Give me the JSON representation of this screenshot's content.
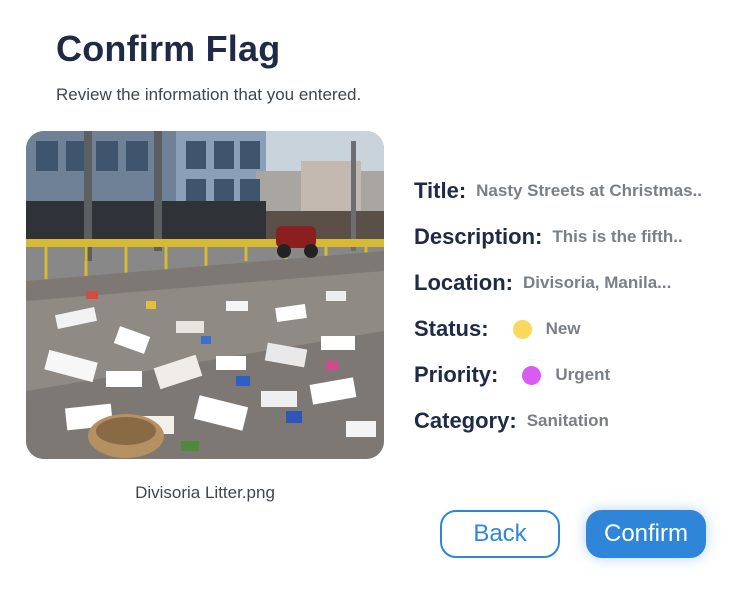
{
  "header": {
    "title": "Confirm Flag",
    "subtitle": "Review the information that you entered."
  },
  "image": {
    "filename": "Divisoria Litter.png"
  },
  "details": {
    "title_label": "Title:",
    "title_value": "Nasty Streets at Christmas..",
    "description_label": "Description:",
    "description_value": "This is the fifth..",
    "location_label": "Location:",
    "location_value": "Divisoria, Manila...",
    "status_label": "Status:",
    "status_value": "New",
    "status_color": "#f9d85b",
    "priority_label": "Priority:",
    "priority_value": "Urgent",
    "priority_color": "#d95cf0",
    "category_label": "Category:",
    "category_value": "Sanitation"
  },
  "actions": {
    "back_label": "Back",
    "confirm_label": "Confirm",
    "accent_color": "#2f86d8"
  }
}
